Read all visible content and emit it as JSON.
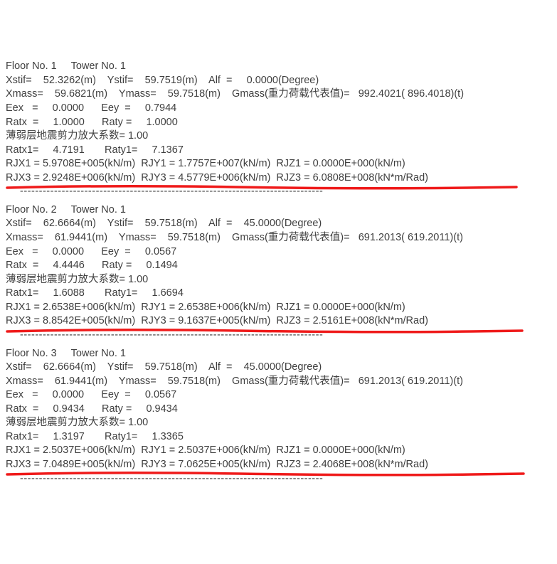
{
  "blocks": [
    {
      "header": "Floor No. 1     Tower No. 1",
      "stif": "Xstif=    52.3262(m)    Ystif=    59.7519(m)    Alf  =     0.0000(Degree)",
      "mass": "Xmass=    59.6821(m)    Ymass=    59.7518(m)    Gmass(重力荷载代表值)=   992.4021( 896.4018)(t)",
      "ee": "Eex   =     0.0000      Eey  =     0.7944",
      "rat": "Ratx  =     1.0000      Raty =     1.0000",
      "weak": "薄弱层地震剪力放大系数= 1.00",
      "rat1": "Ratx1=     4.7191       Raty1=     7.1367",
      "rj1": "RJX1 = 5.9708E+005(kN/m)  RJY1 = 1.7757E+007(kN/m)  RJZ1 = 0.0000E+000(kN/m)",
      "rj3": "RJX3 = 2.9248E+006(kN/m)  RJY3 = 4.5779E+006(kN/m)  RJZ3 = 6.0808E+008(kN*m/Rad)",
      "dashes": "--------------------------------------------------------------------------------",
      "underline_width": 720
    },
    {
      "header": "Floor No. 2     Tower No. 1",
      "stif": "Xstif=    62.6664(m)    Ystif=    59.7518(m)    Alf  =    45.0000(Degree)",
      "mass": "Xmass=    61.9441(m)    Ymass=    59.7518(m)    Gmass(重力荷载代表值)=   691.2013( 619.2011)(t)",
      "ee": "Eex   =     0.0000      Eey  =     0.0567",
      "rat": "Ratx  =     4.4446      Raty =     0.1494",
      "weak": "薄弱层地震剪力放大系数= 1.00",
      "rat1": "Ratx1=     1.6088       Raty1=     1.6694",
      "rj1": "RJX1 = 2.6538E+006(kN/m)  RJY1 = 2.6538E+006(kN/m)  RJZ1 = 0.0000E+000(kN/m)",
      "rj3": "RJX3 = 8.8542E+005(kN/m)  RJY3 = 9.1637E+005(kN/m)  RJZ3 = 2.5161E+008(kN*m/Rad)",
      "dashes": "--------------------------------------------------------------------------------",
      "underline_width": 728
    },
    {
      "header": "Floor No. 3     Tower No. 1",
      "stif": "Xstif=    62.6664(m)    Ystif=    59.7518(m)    Alf  =    45.0000(Degree)",
      "mass": "Xmass=    61.9441(m)    Ymass=    59.7518(m)    Gmass(重力荷载代表值)=   691.2013( 619.2011)(t)",
      "ee": "Eex   =     0.0000      Eey  =     0.0567",
      "rat": "Ratx  =     0.9434      Raty =     0.9434",
      "weak": "薄弱层地震剪力放大系数= 1.00",
      "rat1": "Ratx1=     1.3197       Raty1=     1.3365",
      "rj1": "RJX1 = 2.5037E+006(kN/m)  RJY1 = 2.5037E+006(kN/m)  RJZ1 = 0.0000E+000(kN/m)",
      "rj3": "RJX3 = 7.0489E+005(kN/m)  RJY3 = 7.0625E+005(kN/m)  RJZ3 = 2.4068E+008(kN*m/Rad)",
      "dashes": "--------------------------------------------------------------------------------",
      "underline_width": 730
    }
  ],
  "style": {
    "underline_color": "#ef1a1a",
    "underline_stroke": 3.5
  }
}
